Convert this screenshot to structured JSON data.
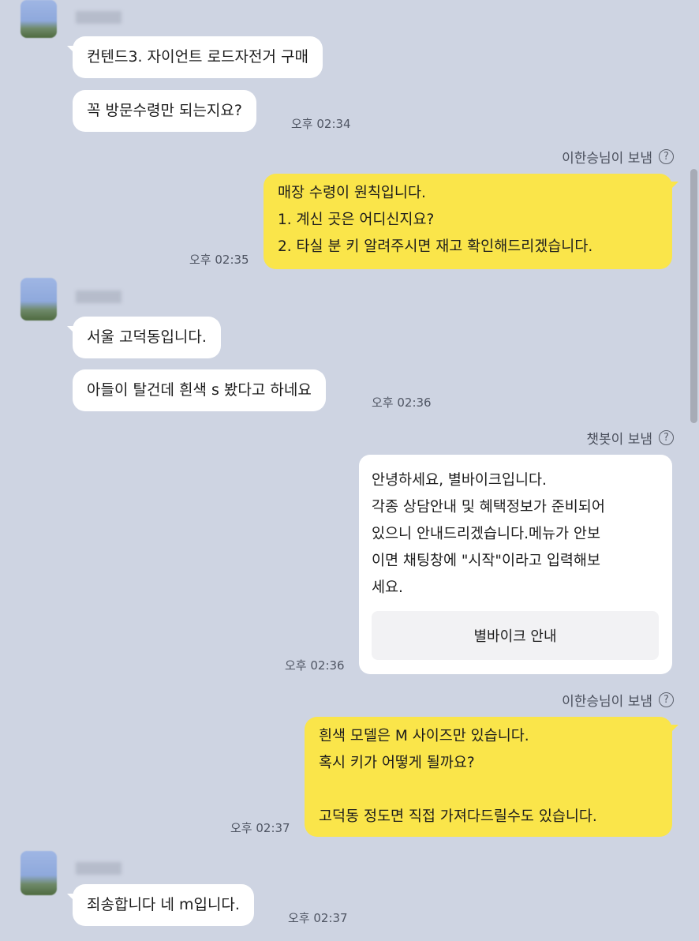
{
  "messages": {
    "m1": "컨텐드3. 자이언트 로드자전거 구매",
    "m2": "꼭 방문수령만 되는지요?",
    "t1": "오후 02:34",
    "s1": "이한승님이 보냄",
    "y1": "매장 수령이 원칙입니다.\n1. 계신 곳은 어디신지요?\n2. 타실 분 키 알려주시면 재고 확인해드리겠습니다.",
    "t2": "오후 02:35",
    "m3": "서울 고덕동입니다.",
    "m4": "아들이 탈건데 흰색 s 봤다고 하네요",
    "t3": "오후 02:36",
    "s2": "챗봇이 보냄",
    "card_text": "안녕하세요, 별바이크입니다.\n각종 상담안내 및 혜택정보가 준비되어\n있으니 안내드리겠습니다.메뉴가 안보\n이면 채팅창에 \"시작\"이라고 입력해보\n세요.",
    "card_button": "별바이크 안내",
    "t4": "오후 02:36",
    "s3": "이한승님이 보냄",
    "y2": "흰색 모델은 M 사이즈만 있습니다.\n혹시 키가 어떻게 될까요?\n\n고덕동 정도면 직접 가져다드릴수도 있습니다.",
    "t5": "오후 02:37",
    "m5": "죄송합니다 네 m입니다.",
    "t6": "오후 02:37"
  },
  "icons": {
    "help": "?"
  },
  "colors": {
    "background": "#ced4e2",
    "my_bubble": "#fae54a",
    "other_bubble": "#ffffff"
  }
}
